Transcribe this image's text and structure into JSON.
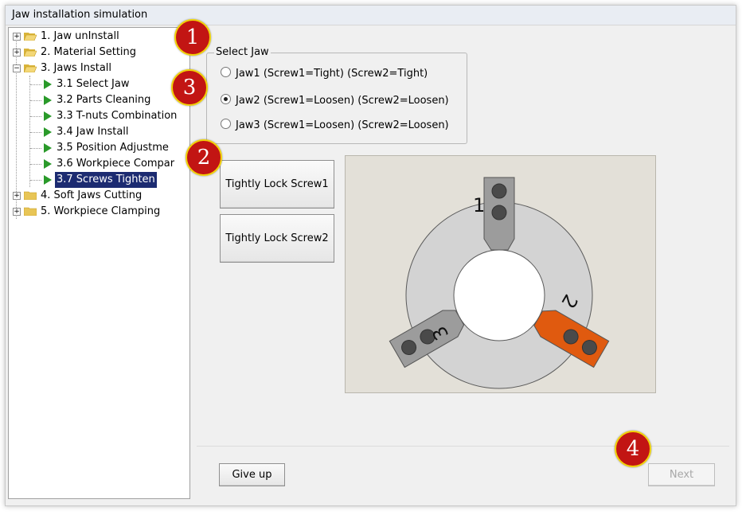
{
  "window": {
    "title": "Jaw installation simulation"
  },
  "tree": {
    "items": [
      {
        "label": "1. Jaw unInstall",
        "type": "folder",
        "expander": "+"
      },
      {
        "label": "2. Material Setting",
        "type": "folder",
        "expander": "+"
      },
      {
        "label": "3. Jaws Install",
        "type": "folder",
        "expander": "−"
      },
      {
        "label": "3.1 Select Jaw",
        "type": "step"
      },
      {
        "label": "3.2 Parts Cleaning",
        "type": "step"
      },
      {
        "label": "3.3 T-nuts Combination",
        "type": "step"
      },
      {
        "label": "3.4 Jaw Install",
        "type": "step"
      },
      {
        "label": "3.5 Position Adjustme",
        "type": "step"
      },
      {
        "label": "3.6 Workpiece Compar",
        "type": "step"
      },
      {
        "label": "3.7 Screws Tighten",
        "type": "step",
        "selected": true
      },
      {
        "label": "4. Soft Jaws Cutting",
        "type": "folder",
        "expander": "+"
      },
      {
        "label": "5. Workpiece Clamping",
        "type": "folder",
        "expander": "+"
      }
    ]
  },
  "select_jaw": {
    "label": "Select Jaw",
    "options": [
      {
        "label": "Jaw1 (Screw1=Tight) (Screw2=Tight)",
        "checked": false
      },
      {
        "label": "Jaw2 (Screw1=Loosen) (Screw2=Loosen)",
        "checked": true
      },
      {
        "label": "Jaw3 (Screw1=Loosen) (Screw2=Loosen)",
        "checked": false
      }
    ]
  },
  "actions": {
    "lock_screw1": "Tightly Lock Screw1",
    "lock_screw2": "Tightly Lock Screw2",
    "give_up": "Give up",
    "next": "Next"
  },
  "chuck": {
    "jaw_labels": [
      "1",
      "2",
      "3"
    ],
    "colors": {
      "jaw_default": "#9c9c9c",
      "jaw_selected": "#e05a0f",
      "ring": "#d3d3d3",
      "bolt": "#4a4a4a"
    }
  },
  "markers": [
    "1",
    "2",
    "3",
    "4"
  ],
  "colors": {
    "marker_fill": "#c21513",
    "marker_border": "#f1d20a",
    "selection": "#1c2b71"
  }
}
